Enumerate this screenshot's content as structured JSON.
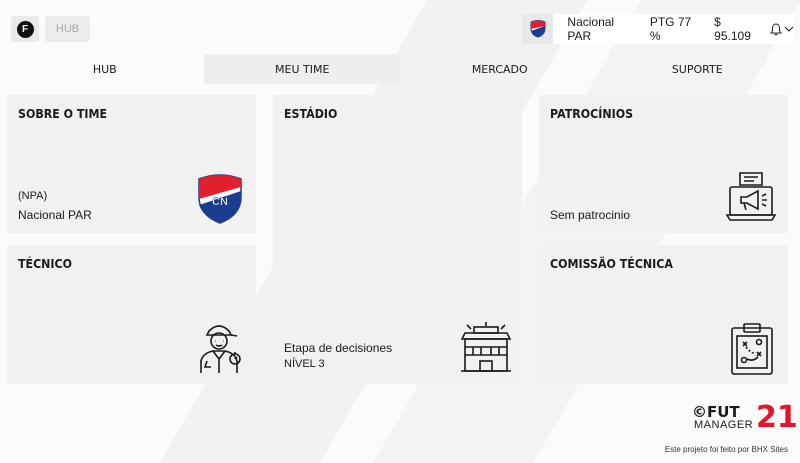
{
  "header": {
    "logo_letter": "F",
    "breadcrumb": "HUB",
    "team_name": "Nacional PAR",
    "ptg": "PTG 77 %",
    "money": "$ 95.109",
    "team_crest_icon": "team-crest-icon",
    "bell_icon": "bell-icon",
    "chevron_icon": "chevron-down-icon"
  },
  "tabs": [
    {
      "label": "HUB",
      "active": false
    },
    {
      "label": "MEU TIME",
      "active": true
    },
    {
      "label": "MERCADO",
      "active": false
    },
    {
      "label": "SUPORTE",
      "active": false
    }
  ],
  "cards": {
    "sobre": {
      "title": "SOBRE O TIME",
      "sub": "(NPA)",
      "main": "Nacional PAR",
      "crest_text": "CN",
      "icon": "team-crest-icon"
    },
    "estadio": {
      "title": "ESTÁDIO",
      "main": "Etapa de decisiones",
      "sub": "NÍVEL 3",
      "icon": "stadium-icon"
    },
    "patrocinios": {
      "title": "PATROCÍNIOS",
      "main": "Sem patrocinio",
      "icon": "sponsorship-megaphone-icon"
    },
    "tecnico": {
      "title": "TÉCNICO",
      "icon": "coach-icon"
    },
    "comissao": {
      "title": "COMISSÃO TÉCNICA",
      "icon": "tactics-clipboard-icon"
    }
  },
  "brand": {
    "fut": "©FUT",
    "manager": "MANAGER",
    "year": "21",
    "credit": "Este projeto foi feito por BHX Sites"
  },
  "colors": {
    "card_bg": "#f1f1f1",
    "tab_active_bg": "#eeeeee",
    "brand_red": "#e3152b",
    "crest_red": "#e0202f",
    "crest_blue": "#1a3d8f"
  }
}
